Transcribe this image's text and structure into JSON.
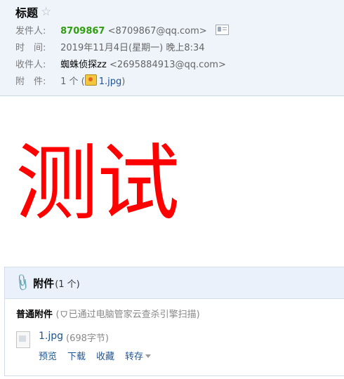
{
  "email": {
    "subject": "标题",
    "from_label": "发件人:",
    "from_name": "8709867",
    "from_address": "<8709867@qq.com>",
    "time_label": "时　间:",
    "time_value": "2019年11月4日(星期一) 晚上8:34",
    "to_label": "收件人:",
    "to_name": "蜘蛛侦探zz",
    "to_address": "<2695884913@qq.com>",
    "attach_label": "附　件:",
    "attach_summary_prefix": "1 个 (",
    "attach_summary_file": "1.jpg",
    "attach_summary_suffix": ")"
  },
  "body": {
    "text": "测试",
    "color": "#ff0000"
  },
  "attachments": {
    "header_title": "附件",
    "header_count": "(1 个)",
    "section_label": "普通附件",
    "scan_note_open": "(",
    "scan_note": "已通过电脑管家云查杀引擎扫描)",
    "files": [
      {
        "name": "1.jpg",
        "size": "(698字节)",
        "actions": [
          "预览",
          "下载",
          "收藏",
          "转存"
        ]
      }
    ]
  },
  "icons": {
    "star": "star-outline-icon",
    "vcard": "contact-card-icon",
    "image": "image-thumbnail-icon",
    "paperclip": "paperclip-icon",
    "shield": "shield-icon"
  },
  "colors": {
    "header_bg": "#eff4fa",
    "sender": "#2f9e0e",
    "link": "#1e5494"
  }
}
